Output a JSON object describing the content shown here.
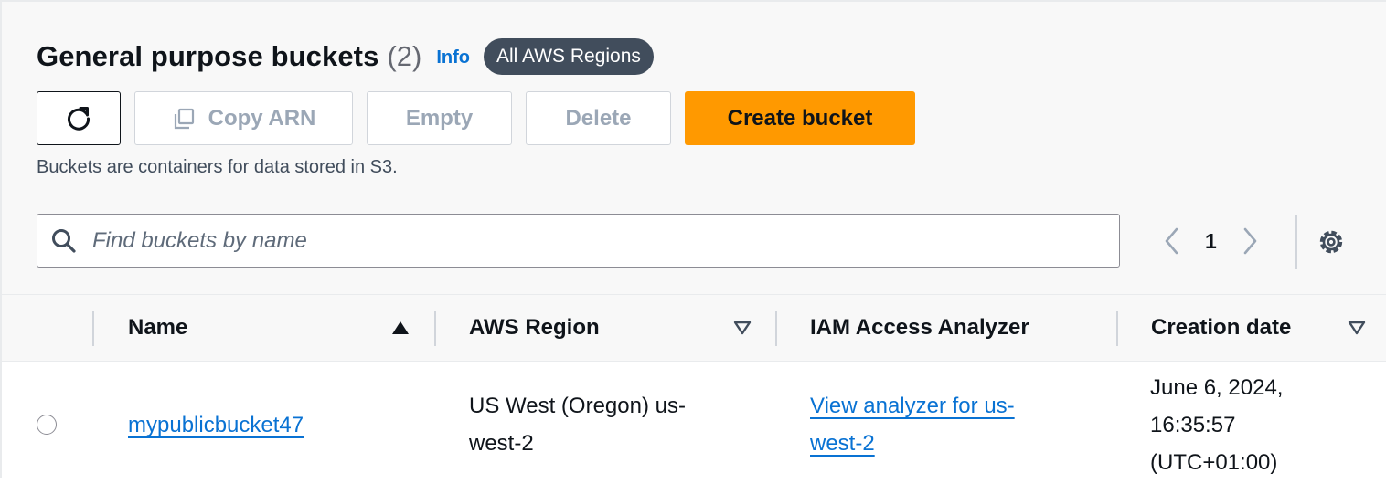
{
  "header": {
    "title": "General purpose buckets",
    "count": "(2)",
    "info_label": "Info",
    "region_pill": "All AWS Regions"
  },
  "toolbar": {
    "refresh_icon": "refresh-icon",
    "copy_arn_label": "Copy ARN",
    "empty_label": "Empty",
    "delete_label": "Delete",
    "create_label": "Create bucket"
  },
  "description": "Buckets are containers for data stored in S3.",
  "search": {
    "placeholder": "Find buckets by name",
    "value": ""
  },
  "pagination": {
    "current_page": "1"
  },
  "table": {
    "columns": [
      "Name",
      "AWS Region",
      "IAM Access Analyzer",
      "Creation date"
    ],
    "sort": {
      "column": "Name",
      "direction": "ascending"
    },
    "rows": [
      {
        "name": "mypublicbucket47",
        "region_line1": "US West (Oregon) us-",
        "region_line2": "west-2",
        "analyzer_line1": "View analyzer for us-",
        "analyzer_line2": "west-2",
        "date_line1": "June 6, 2024,",
        "date_line2": "16:35:57",
        "date_line3": "(UTC+01:00)"
      }
    ]
  },
  "colors": {
    "accent": "#0972d3",
    "primary_button": "#ff9900",
    "pill_bg": "#414d5c"
  }
}
